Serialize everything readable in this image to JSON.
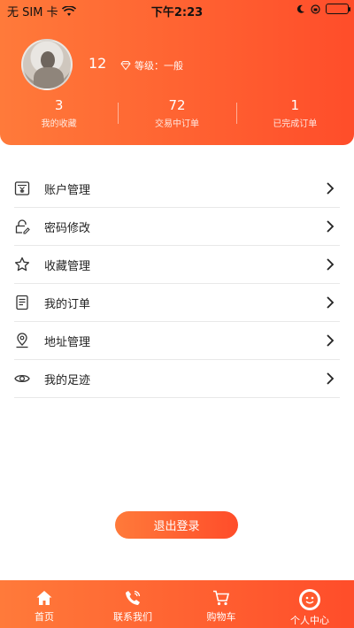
{
  "status_bar": {
    "carrier": "无 SIM 卡",
    "time": "下午2:23"
  },
  "profile": {
    "username": "12",
    "level_label": "等级：一般"
  },
  "stats": [
    {
      "value": "3",
      "label": "我的收藏"
    },
    {
      "value": "72",
      "label": "交易中订单"
    },
    {
      "value": "1",
      "label": "已完成订单"
    }
  ],
  "menu": [
    {
      "label": "账户管理",
      "icon": "yen-card-icon"
    },
    {
      "label": "密码修改",
      "icon": "lock-edit-icon"
    },
    {
      "label": "收藏管理",
      "icon": "star-icon"
    },
    {
      "label": "我的订单",
      "icon": "document-icon"
    },
    {
      "label": "地址管理",
      "icon": "location-pin-icon"
    },
    {
      "label": "我的足迹",
      "icon": "eye-icon"
    }
  ],
  "logout_label": "退出登录",
  "tabs": [
    {
      "label": "首页",
      "icon": "home-icon"
    },
    {
      "label": "联系我们",
      "icon": "phone-icon"
    },
    {
      "label": "购物车",
      "icon": "cart-icon"
    },
    {
      "label": "个人中心",
      "icon": "smile-face-icon",
      "active": true
    }
  ],
  "colors": {
    "accent_start": "#ff7a3a",
    "accent_end": "#ff4d2a"
  }
}
